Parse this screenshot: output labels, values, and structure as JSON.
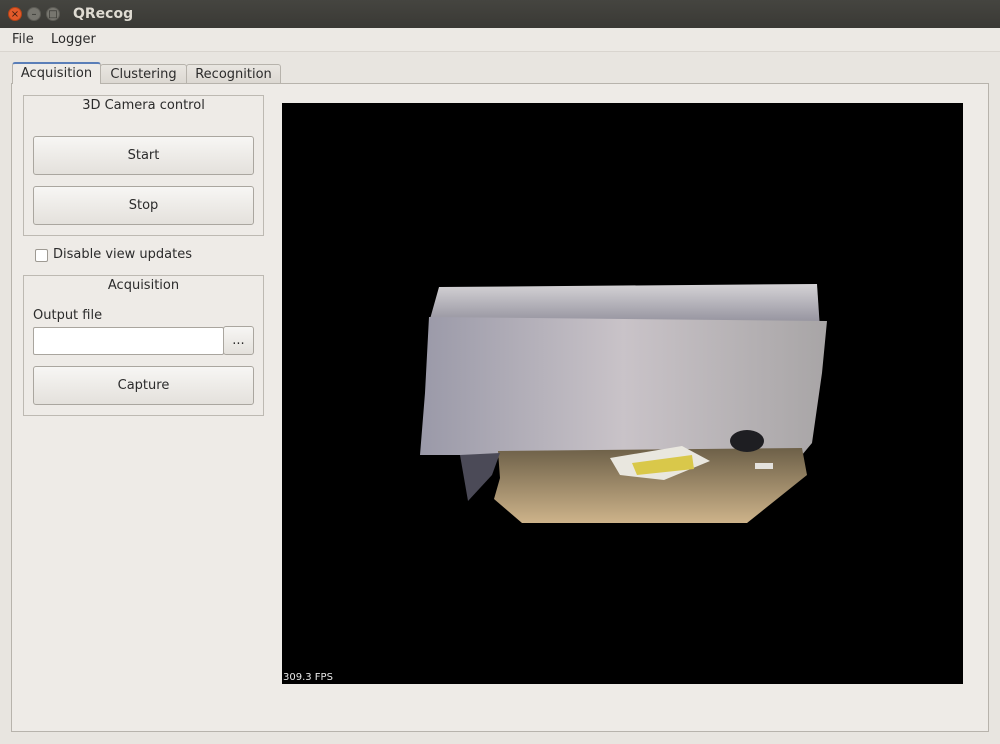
{
  "window": {
    "title": "QRecog",
    "close_glyph": "×",
    "minimize_glyph": "–",
    "maximize_glyph": "□"
  },
  "menu": {
    "items": [
      "File",
      "Logger"
    ]
  },
  "tabs": [
    {
      "label": "Acquisition",
      "active": true
    },
    {
      "label": "Clustering",
      "active": false
    },
    {
      "label": "Recognition",
      "active": false
    }
  ],
  "camera_control": {
    "title": "3D Camera control",
    "start_label": "Start",
    "stop_label": "Stop"
  },
  "disable_updates": {
    "label": "Disable view updates",
    "checked": false
  },
  "acquisition": {
    "title": "Acquisition",
    "output_label": "Output file",
    "output_value": "",
    "browse_label": "...",
    "capture_label": "Capture"
  },
  "view": {
    "fps_text": "309.3 FPS"
  }
}
